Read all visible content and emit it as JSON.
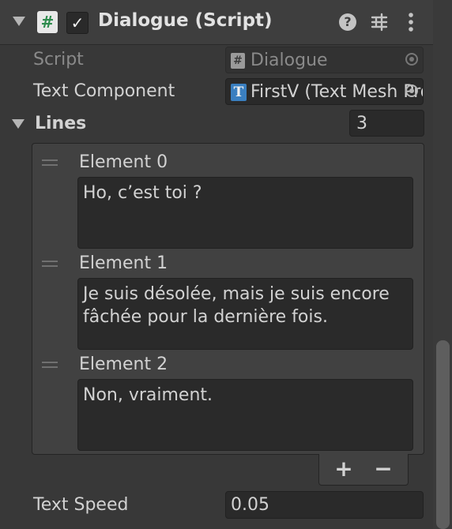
{
  "component": {
    "title": "Dialogue (Script)",
    "enabled_mark": "✓",
    "script_icon_glyph": "#",
    "help_glyph": "?",
    "icons": [
      "foldout-arrow-icon",
      "script-icon",
      "checkbox-icon",
      "help-icon",
      "presets-icon",
      "more-icon"
    ]
  },
  "fields": {
    "script": {
      "label": "Script",
      "value": "Dialogue",
      "icon_glyph": "#"
    },
    "text_component": {
      "label": "Text Component",
      "value": "FirstV (Text Mesh Pro UGUI)",
      "icon_glyph": "T"
    }
  },
  "lines": {
    "label": "Lines",
    "size": "3",
    "elements": [
      {
        "label": "Element 0",
        "value": "Ho, c’est toi ?"
      },
      {
        "label": "Element 1",
        "value": "Je suis désolée, mais je suis encore fâchée pour la dernière fois."
      },
      {
        "label": "Element 2",
        "value": "Non, vraiment."
      }
    ],
    "add_label": "+",
    "remove_label": "−"
  },
  "text_speed": {
    "label": "Text Speed",
    "value": "0.05"
  },
  "colors": {
    "background": "#383838",
    "field_background": "#2a2a2a",
    "script_icon_green": "#2e8b4d",
    "text_icon_blue": "#3a7fc0"
  }
}
